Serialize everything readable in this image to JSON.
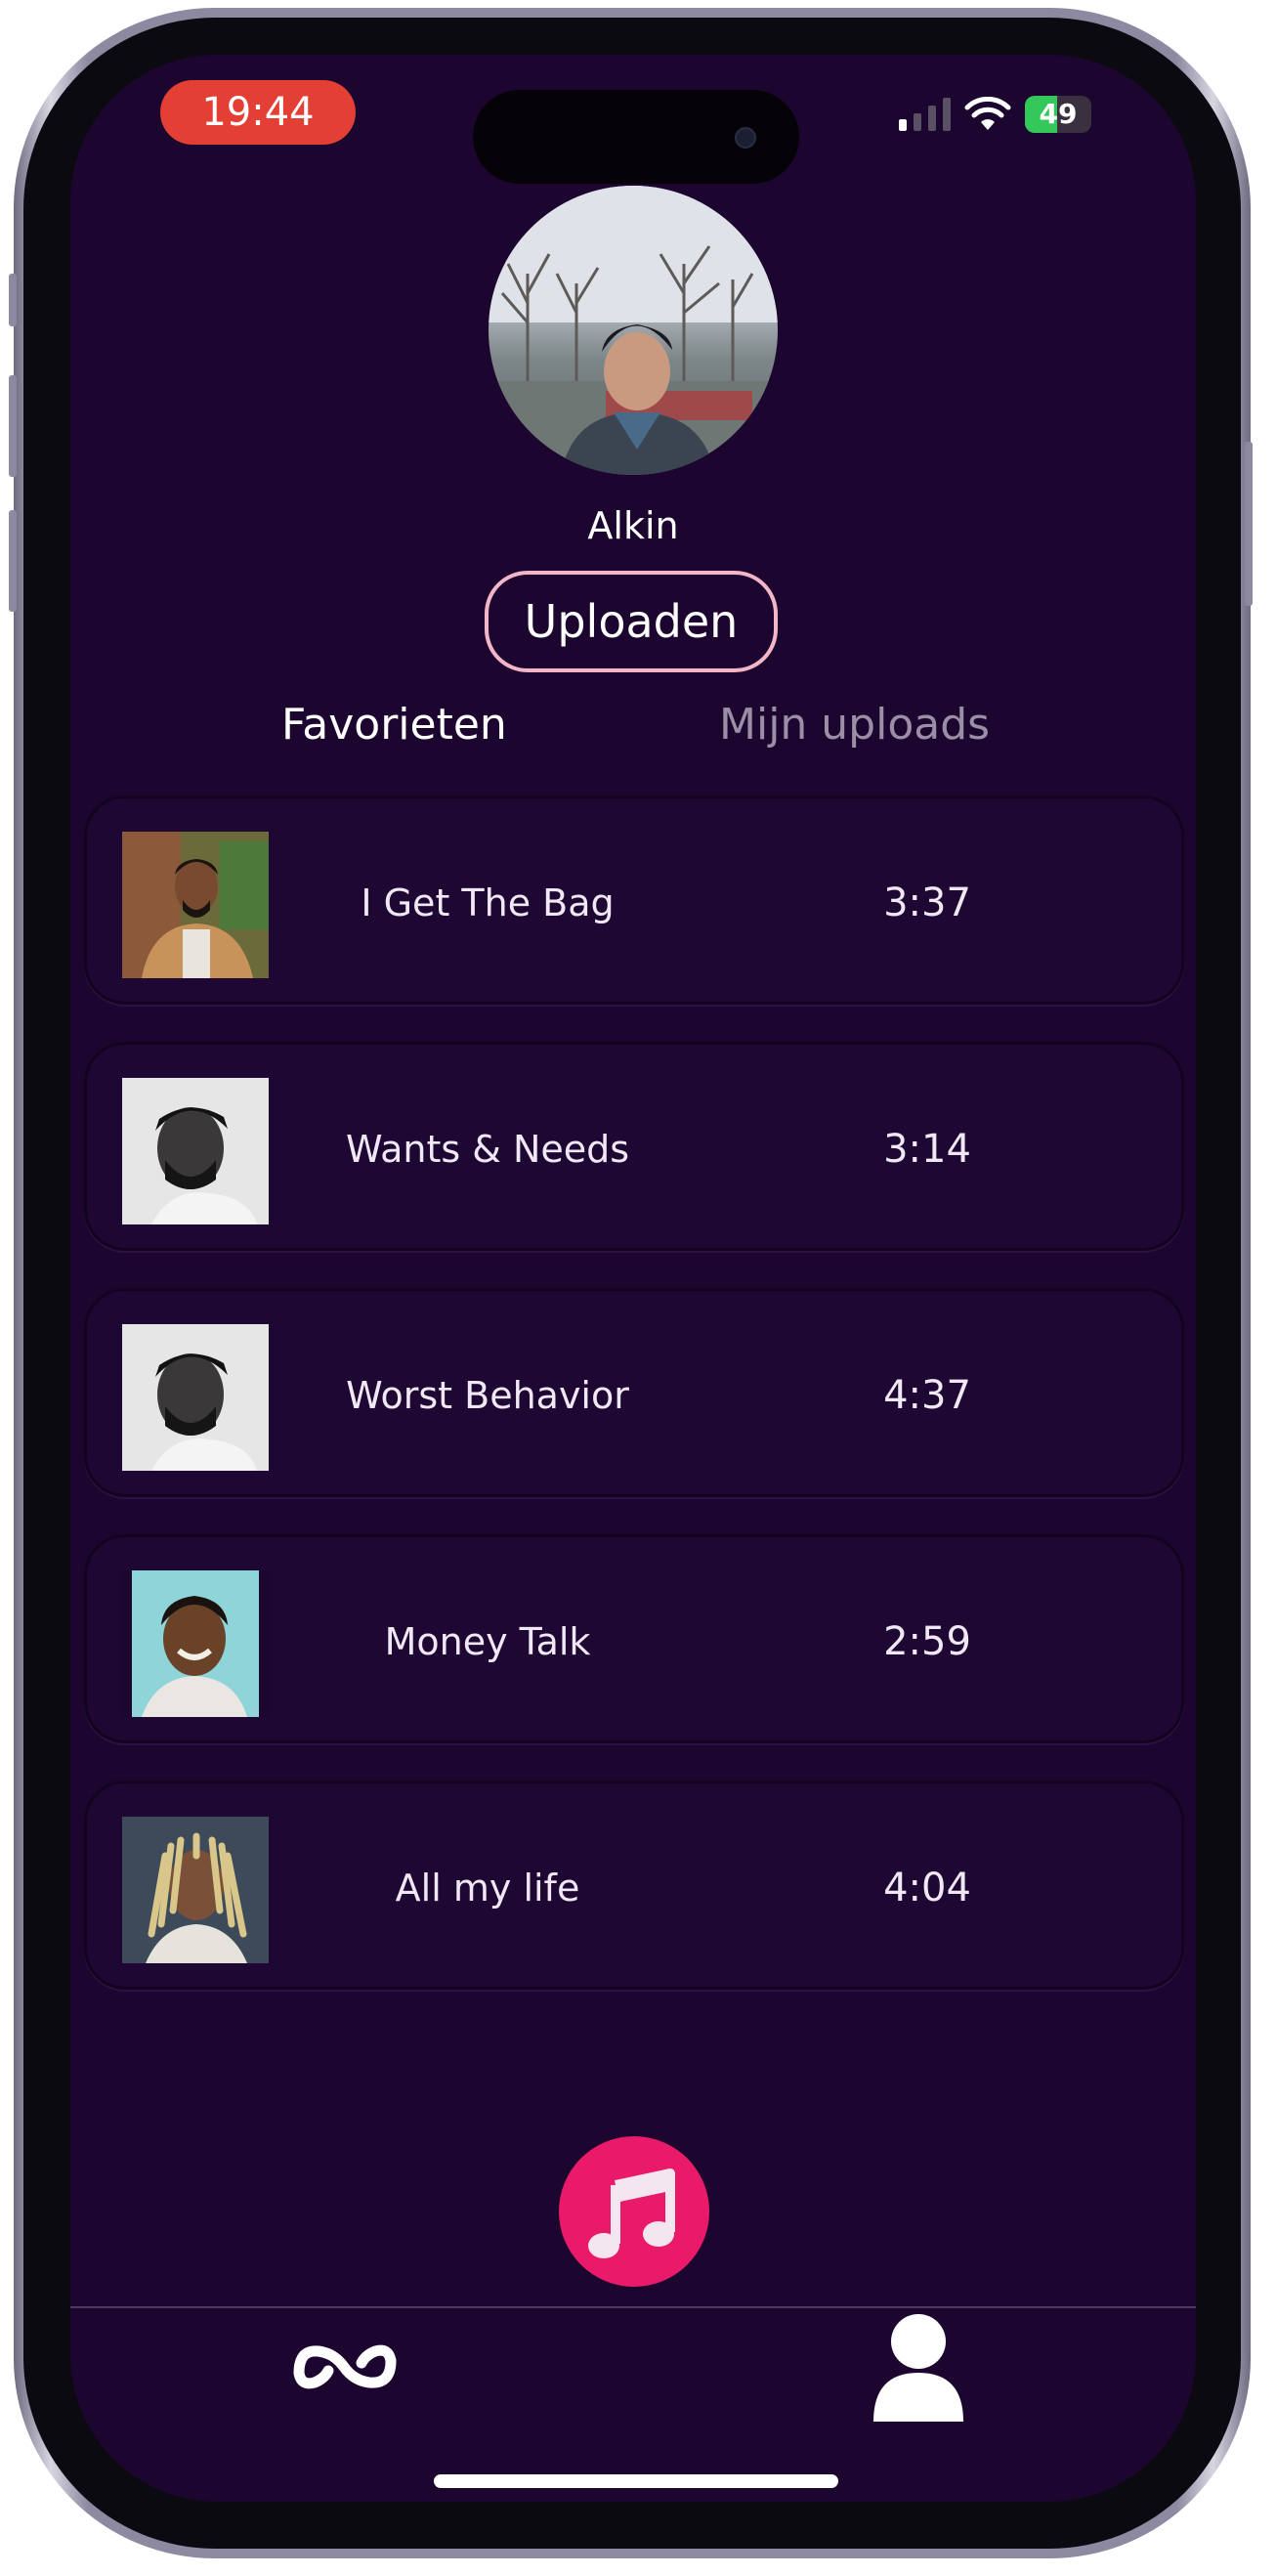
{
  "status_bar": {
    "time": "19:44",
    "battery": "49"
  },
  "profile": {
    "name": "Alkin",
    "upload_label": "Uploaden"
  },
  "tabs": [
    {
      "label": "Favorieten",
      "active": true
    },
    {
      "label": "Mijn uploads",
      "active": false
    }
  ],
  "songs": [
    {
      "title": "I Get The Bag",
      "duration": "3:37"
    },
    {
      "title": "Wants & Needs",
      "duration": "3:14"
    },
    {
      "title": "Worst Behavior",
      "duration": "4:37"
    },
    {
      "title": "Money Talk",
      "duration": "2:59"
    },
    {
      "title": "All my life",
      "duration": "4:04"
    }
  ],
  "nav": {
    "left_icon": "infinity-loop-icon",
    "center_icon": "music-note-icon",
    "right_icon": "user-profile-icon"
  },
  "colors": {
    "background": "#1c0630",
    "accent": "#ea1a6a",
    "upload_border": "#f3b6c8",
    "status_time": "#e43f34"
  }
}
